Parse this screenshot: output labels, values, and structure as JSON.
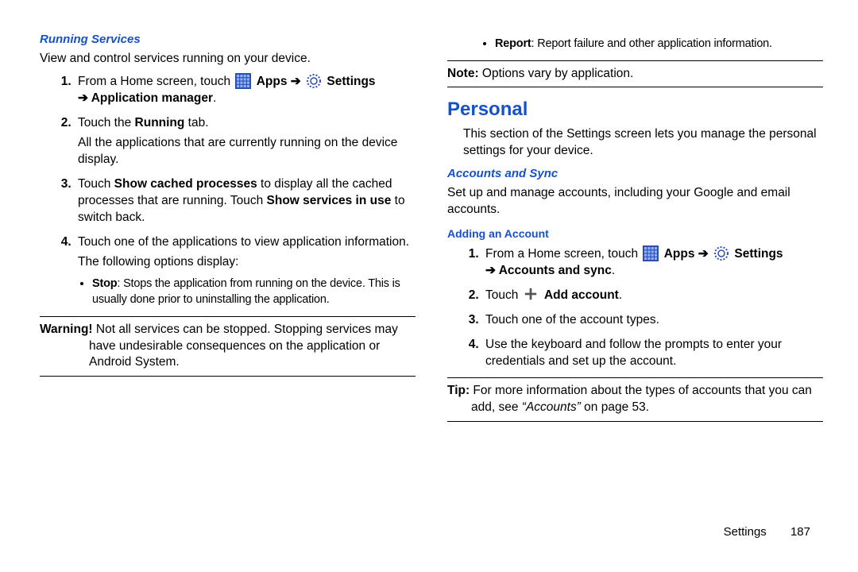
{
  "footer": {
    "section": "Settings",
    "page": "187"
  },
  "left": {
    "running_services_h": "Running Services",
    "running_services_intro": "View and control services running on your device.",
    "step1_prefix": "From a Home screen, touch ",
    "apps_bold": "Apps",
    "settings_bold": "Settings",
    "arrow_appmgr": "Application manager",
    "step2_a": "Touch the ",
    "step2_running": "Running",
    "step2_b": " tab.",
    "step2_body": "All the applications that are currently running on the device display.",
    "step3_a": "Touch ",
    "step3_show_cached": "Show cached processes",
    "step3_b": " to display all the cached processes that are running. Touch ",
    "step3_services_in_use": "Show services in use",
    "step3_c": " to switch back.",
    "step4": "Touch one of the applications to view application information.",
    "step4_body": "The following options display:",
    "bullet_stop_label": "Stop",
    "bullet_stop_text": ": Stops the application from running on the device. This is usually done prior to uninstalling the application.",
    "warning_label": "Warning!",
    "warning_text": " Not all services can be stopped. Stopping services may have undesirable consequences on the application or Android System."
  },
  "right": {
    "bullet_report_label": "Report",
    "bullet_report_text": ": Report failure and other application information.",
    "note_label": "Note:",
    "note_text": " Options vary by application.",
    "personal_h": "Personal",
    "personal_intro": "This section of the Settings screen lets you manage the personal settings for your device.",
    "accounts_sync_h": "Accounts and Sync",
    "accounts_sync_intro": "Set up and manage accounts, including your Google and email accounts.",
    "adding_account_h": "Adding an Account",
    "r_step1_prefix": "From a Home screen, touch ",
    "r_apps_bold": "Apps",
    "r_settings_bold": "Settings",
    "r_arrow_acc_sync": "Accounts and sync",
    "r_step2_a": "Touch ",
    "r_step2_add_account": "Add account",
    "r_step3": "Touch one of the account types.",
    "r_step4": "Use the keyboard and follow the prompts to enter your credentials and set up the account.",
    "tip_label": "Tip:",
    "tip_text_a": " For more information about the types of accounts that you can add, see ",
    "tip_quote": "“Accounts”",
    "tip_text_b": " on page 53."
  }
}
